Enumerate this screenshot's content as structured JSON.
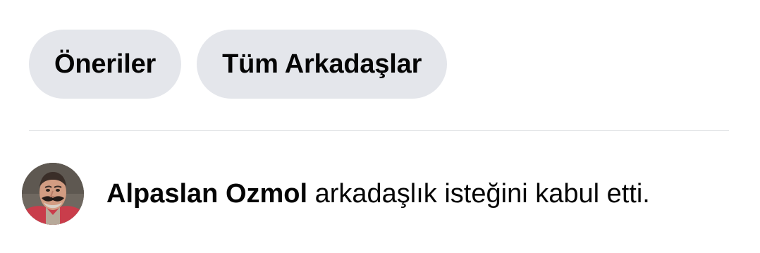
{
  "tabs": [
    {
      "label": "Öneriler"
    },
    {
      "label": "Tüm Arkadaşlar"
    }
  ],
  "notification": {
    "name": "Alpaslan Ozmol",
    "message": " arkadaşlık isteğini kabul etti.",
    "avatar_alt": "Alpaslan Ozmol profile photo"
  },
  "colors": {
    "chip_background": "#e4e6eb",
    "text": "#050505",
    "divider": "#dddfe2"
  }
}
